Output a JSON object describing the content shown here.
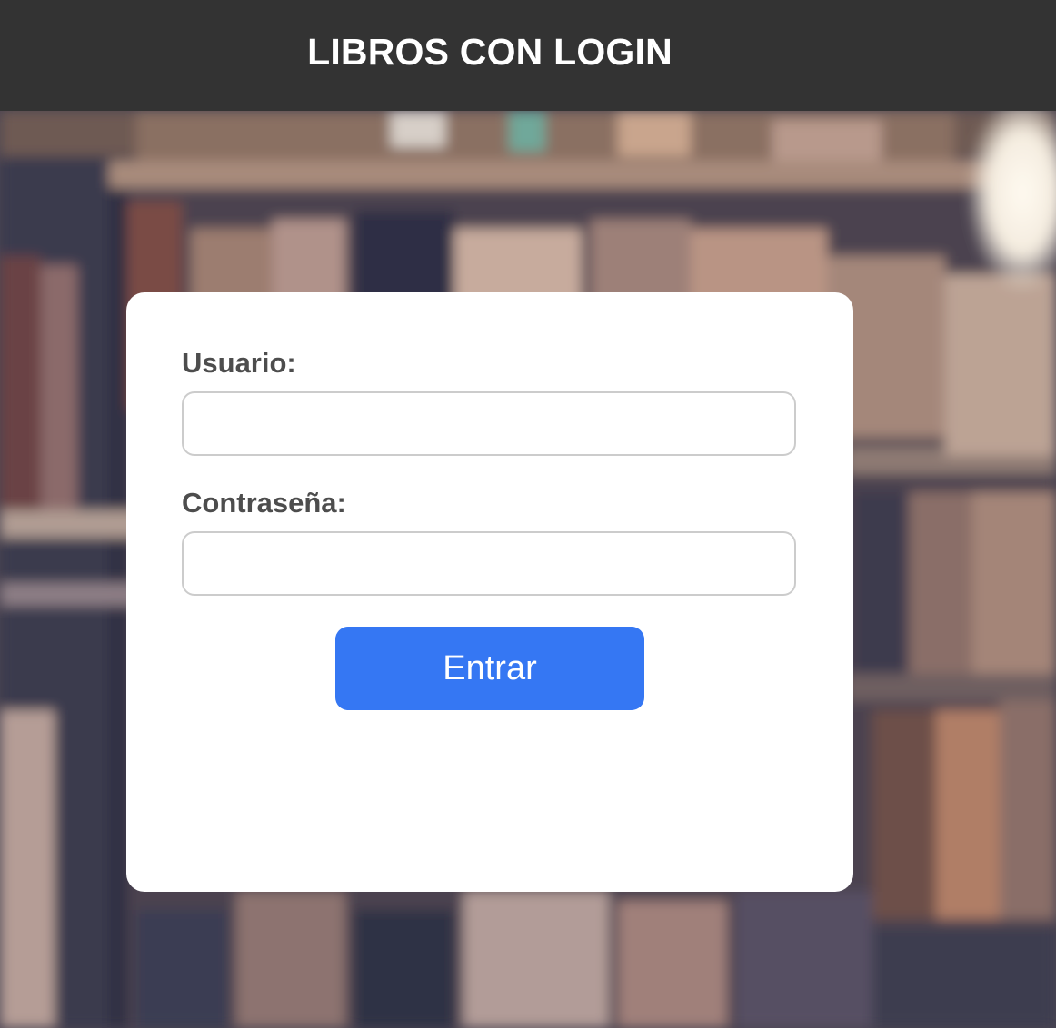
{
  "header": {
    "title": "LIBROS CON LOGIN"
  },
  "login_form": {
    "username_label": "Usuario:",
    "username_value": "",
    "password_label": "Contraseña:",
    "password_value": "",
    "submit_label": "Entrar"
  },
  "colors": {
    "header_background": "#333333",
    "button_background": "#3577f3",
    "label_text": "#4d4d4d"
  }
}
